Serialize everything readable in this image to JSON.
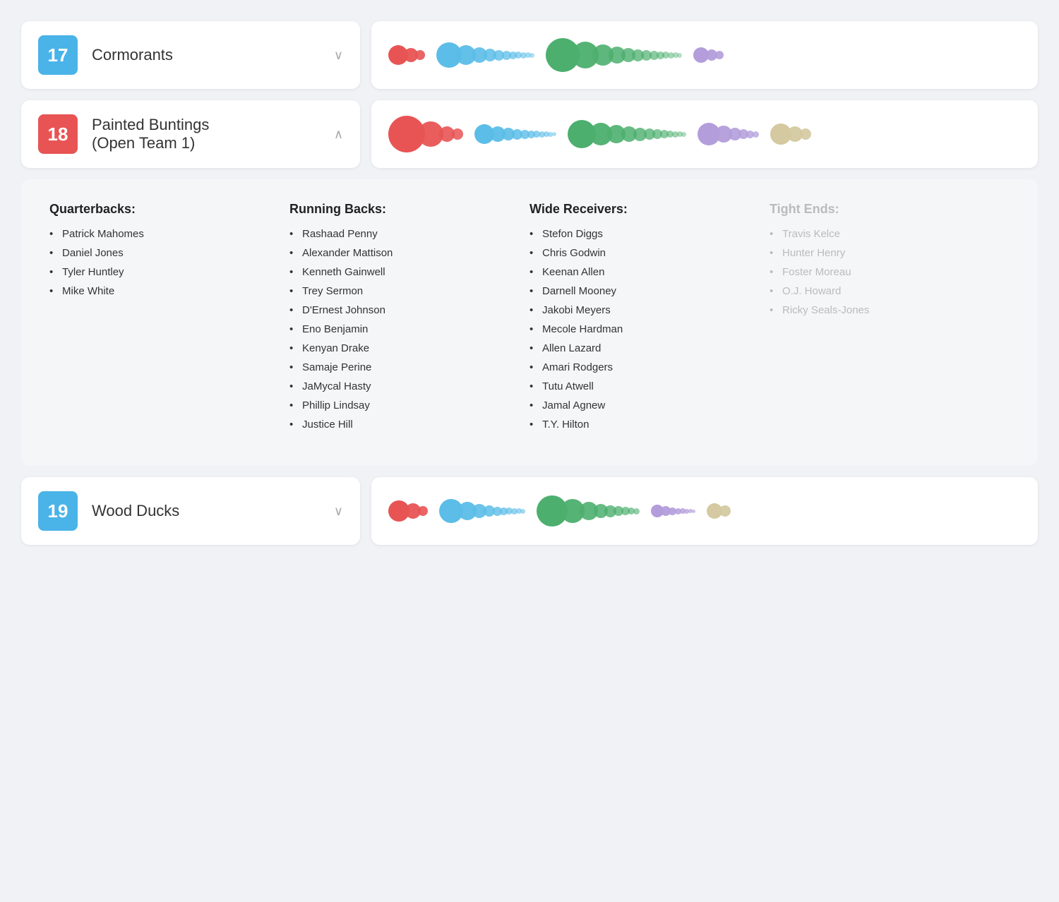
{
  "teams": [
    {
      "id": "17",
      "name": "Cormorants",
      "numberColor": "blue",
      "expanded": false,
      "chevronDirection": "down",
      "bubbleGroups": [
        {
          "color": "#e85454",
          "sizes": [
            28,
            20,
            14
          ]
        },
        {
          "color": "#5bbde8",
          "sizes": [
            36,
            28,
            22,
            18,
            15,
            13,
            11,
            10,
            9,
            8,
            7
          ]
        },
        {
          "color": "#4caf6e",
          "sizes": [
            48,
            38,
            30,
            24,
            20,
            17,
            15,
            13,
            11,
            10,
            9,
            8,
            7
          ]
        },
        {
          "color": "#b39ddb",
          "sizes": [
            22,
            16,
            12
          ]
        }
      ]
    },
    {
      "id": "18",
      "name": "Painted Buntings\n(Open Team 1)",
      "numberColor": "red",
      "expanded": true,
      "chevronDirection": "up",
      "bubbleGroups": [
        {
          "color": "#e85454",
          "sizes": [
            52,
            36,
            22,
            16
          ]
        },
        {
          "color": "#5bbde8",
          "sizes": [
            28,
            22,
            18,
            15,
            13,
            11,
            10,
            9,
            8,
            7,
            6
          ]
        },
        {
          "color": "#4caf6e",
          "sizes": [
            40,
            32,
            26,
            22,
            19,
            16,
            14,
            12,
            10,
            9,
            8,
            7
          ]
        },
        {
          "color": "#b39ddb",
          "sizes": [
            32,
            24,
            18,
            14,
            11,
            9
          ]
        },
        {
          "color": "#d4c9a0",
          "sizes": [
            30,
            22,
            16
          ]
        }
      ],
      "positions": {
        "quarterbacks": {
          "label": "Quarterbacks:",
          "players": [
            "Patrick Mahomes",
            "Daniel Jones",
            "Tyler Huntley",
            "Mike White"
          ]
        },
        "runningBacks": {
          "label": "Running Backs:",
          "players": [
            "Rashaad Penny",
            "Alexander Mattison",
            "Kenneth Gainwell",
            "Trey Sermon",
            "D'Ernest Johnson",
            "Eno Benjamin",
            "Kenyan Drake",
            "Samaje Perine",
            "JaMycal Hasty",
            "Phillip Lindsay",
            "Justice Hill"
          ]
        },
        "wideReceivers": {
          "label": "Wide Receivers:",
          "players": [
            "Stefon Diggs",
            "Chris Godwin",
            "Keenan Allen",
            "Darnell Mooney",
            "Jakobi Meyers",
            "Mecole Hardman",
            "Allen Lazard",
            "Amari Rodgers",
            "Tutu Atwell",
            "Jamal Agnew",
            "T.Y. Hilton"
          ]
        },
        "tightEnds": {
          "label": "Tight Ends:",
          "players": [
            "Travis Kelce",
            "Hunter Henry",
            "Foster Moreau",
            "O.J. Howard",
            "Ricky Seals-Jones"
          ],
          "faded": true
        }
      }
    },
    {
      "id": "19",
      "name": "Wood Ducks",
      "numberColor": "blue",
      "expanded": false,
      "chevronDirection": "down",
      "bubbleGroups": [
        {
          "color": "#e85454",
          "sizes": [
            30,
            22,
            14
          ]
        },
        {
          "color": "#5bbde8",
          "sizes": [
            34,
            26,
            20,
            16,
            13,
            11,
            10,
            9,
            8,
            7
          ]
        },
        {
          "color": "#4caf6e",
          "sizes": [
            44,
            34,
            26,
            20,
            17,
            14,
            12,
            10,
            9
          ]
        },
        {
          "color": "#b39ddb",
          "sizes": [
            18,
            14,
            11,
            9,
            8,
            7,
            6,
            5
          ]
        },
        {
          "color": "#d4c9a0",
          "sizes": [
            22,
            16
          ]
        }
      ]
    }
  ],
  "chevron": {
    "down": "∨",
    "up": "∧"
  }
}
